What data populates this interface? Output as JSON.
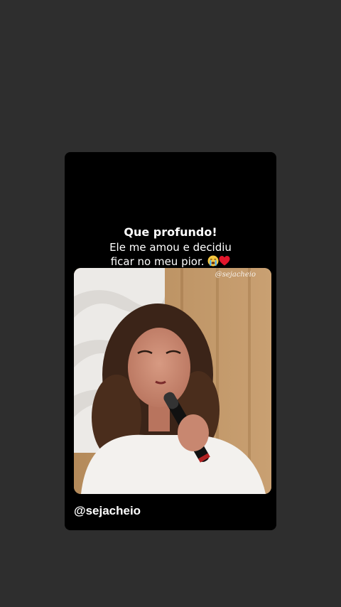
{
  "post": {
    "title": "Que profundo!",
    "line1": "Ele me amou e decidiu",
    "line2": "ficar no meu pior.",
    "emojis": [
      "crying-face-emoji",
      "red-heart-emoji"
    ],
    "handle": "@sejacheio"
  },
  "video": {
    "watermark": "@sejacheio"
  },
  "colors": {
    "page_background": "#2e2e2e",
    "card_background": "#000000",
    "text": "#ffffff"
  }
}
